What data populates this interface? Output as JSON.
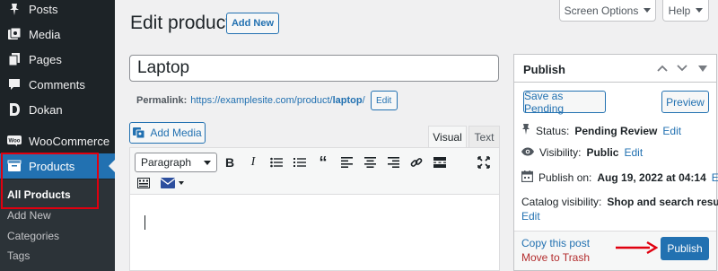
{
  "sidebar": {
    "items": [
      {
        "label": "Posts",
        "icon": "pin-icon"
      },
      {
        "label": "Media",
        "icon": "media-icon"
      },
      {
        "label": "Pages",
        "icon": "page-icon"
      },
      {
        "label": "Comments",
        "icon": "comment-icon"
      },
      {
        "label": "Dokan",
        "icon": "dokan-icon"
      },
      {
        "label": "WooCommerce",
        "icon": "woocommerce-icon"
      },
      {
        "label": "Products",
        "icon": "products-icon"
      }
    ],
    "submenu": [
      "All Products",
      "Add New",
      "Categories",
      "Tags"
    ]
  },
  "header": {
    "title": "Edit product",
    "add_new": "Add New",
    "screen_options": "Screen Options",
    "help": "Help"
  },
  "post": {
    "title_value": "Laptop",
    "permalink_label": "Permalink:",
    "permalink_base": "https://examplesite.com/product/",
    "permalink_slug": "laptop",
    "permalink_trail": "/",
    "edit_label": "Edit"
  },
  "editor": {
    "add_media": "Add Media",
    "tab_visual": "Visual",
    "tab_text": "Text",
    "format": "Paragraph",
    "toolbar_icons": [
      "bold-icon",
      "italic-icon",
      "bulleted-list-icon",
      "numbered-list-icon",
      "blockquote-icon",
      "align-left-icon",
      "align-center-icon",
      "align-right-icon",
      "link-icon",
      "read-more-icon",
      "fullscreen-icon",
      "toolbar-toggle-icon",
      "mail-icon"
    ]
  },
  "publish": {
    "title": "Publish",
    "save_pending": "Save as Pending",
    "preview": "Preview",
    "status_label": "Status:",
    "status_value": "Pending Review",
    "visibility_label": "Visibility:",
    "visibility_value": "Public",
    "publish_on_label": "Publish on:",
    "publish_on_value": "Aug 19, 2022 at 04:14",
    "catalog_label": "Catalog visibility:",
    "catalog_value": "Shop and search results",
    "edit": "Edit",
    "copy": "Copy this post",
    "trash": "Move to Trash",
    "publish_button": "Publish"
  },
  "colors": {
    "accent": "#2271b1",
    "sidebar": "#1d2327",
    "annotation": "#e0000f"
  }
}
